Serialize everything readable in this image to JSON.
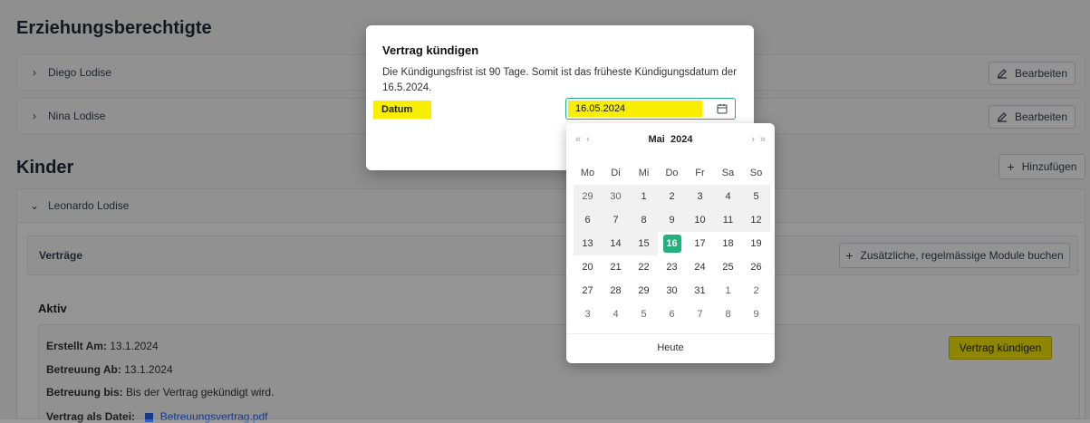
{
  "page": {
    "section_guardians": "Erziehungsberechtigte",
    "guardians": [
      {
        "name": "Diego Lodise",
        "edit_label": "Bearbeiten"
      },
      {
        "name": "Nina Lodise",
        "edit_label": "Bearbeiten"
      }
    ],
    "section_children": "Kinder",
    "add_label": "Hinzufügen",
    "child": {
      "name": "Leonardo Lodise"
    },
    "contracts": {
      "title": "Verträge",
      "book_label": "Zusätzliche, regelmässige Module buchen",
      "active_title": "Aktiv",
      "created_label": "Erstellt Am:",
      "created_value": "13.1.2024",
      "care_from_label": "Betreuung Ab:",
      "care_from_value": "13.1.2024",
      "care_until_label": "Betreuung bis:",
      "care_until_value": "Bis der Vertrag gekündigt wird.",
      "file_label": "Vertrag als Datei:",
      "file_name": "Betreuungsvertrag.pdf",
      "cancel_label": "Vertrag kündigen"
    }
  },
  "modal": {
    "title": "Vertrag kündigen",
    "text": "Die Kündigungsfrist ist 90 Tage. Somit ist das früheste Kündigungsdatum der 16.5.2024.",
    "date_label": "Datum",
    "date_value": "16.05.2024"
  },
  "calendar": {
    "month": "Mai",
    "year": "2024",
    "prev_year": "«",
    "prev_month": "‹",
    "next_month": "›",
    "next_year": "»",
    "weekdays": [
      "Mo",
      "Di",
      "Mi",
      "Do",
      "Fr",
      "Sa",
      "So"
    ],
    "weeks": [
      [
        "29",
        "30",
        "1",
        "2",
        "3",
        "4",
        "5"
      ],
      [
        "6",
        "7",
        "8",
        "9",
        "10",
        "11",
        "12"
      ],
      [
        "13",
        "14",
        "15",
        "16",
        "17",
        "18",
        "19"
      ],
      [
        "20",
        "21",
        "22",
        "23",
        "24",
        "25",
        "26"
      ],
      [
        "27",
        "28",
        "29",
        "30",
        "31",
        "1",
        "2"
      ],
      [
        "3",
        "4",
        "5",
        "6",
        "7",
        "8",
        "9"
      ]
    ],
    "selected": "16",
    "today_label": "Heute"
  },
  "colors": {
    "accent_green": "#22b07d",
    "highlight_yellow": "#f8ef00",
    "link_blue": "#2563eb"
  }
}
